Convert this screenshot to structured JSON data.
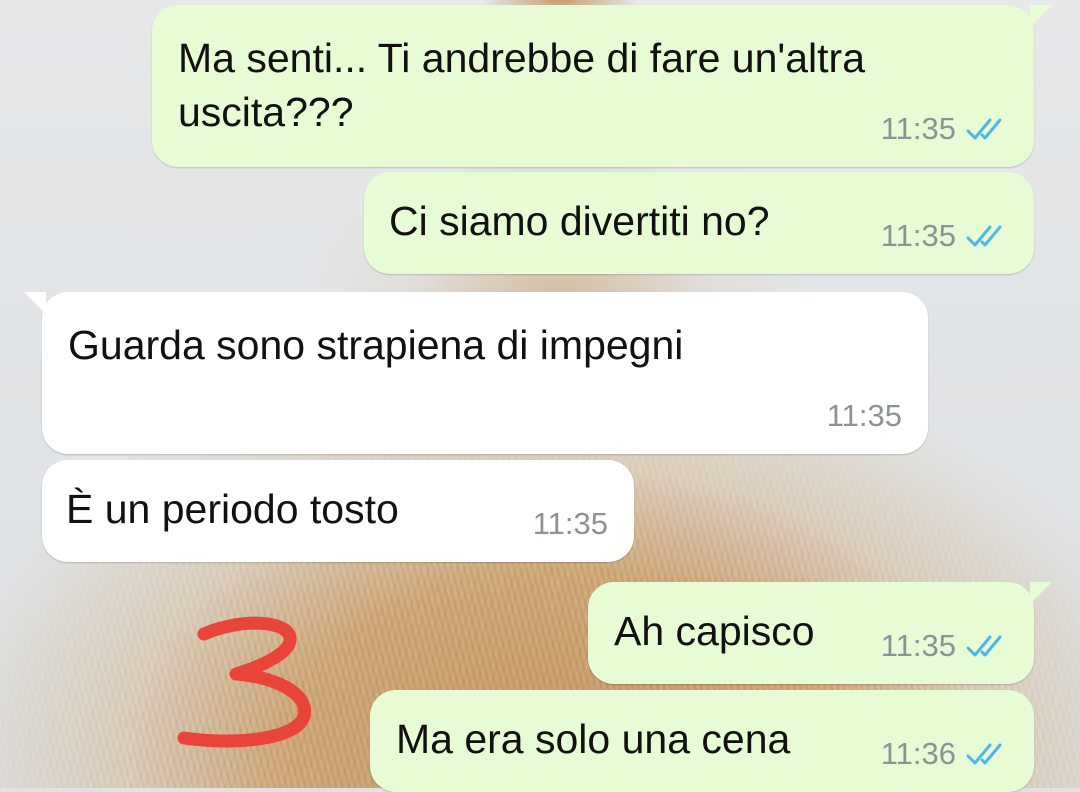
{
  "chat": {
    "messages": [
      {
        "direction": "outgoing",
        "text_line1": "Ma senti... Ti andrebbe di fare un'altra",
        "text_line2": "uscita???",
        "time": "11:35",
        "status": "read"
      },
      {
        "direction": "outgoing",
        "text": "Ci siamo divertiti no?",
        "time": "11:35",
        "status": "read"
      },
      {
        "direction": "incoming",
        "text": "Guarda sono strapiena di impegni",
        "time": "11:35"
      },
      {
        "direction": "incoming",
        "text": "È un periodo tosto",
        "time": "11:35"
      },
      {
        "direction": "outgoing",
        "text": "Ah capisco",
        "time": "11:35",
        "status": "read"
      },
      {
        "direction": "outgoing",
        "text": "Ma era solo una cena",
        "time": "11:36",
        "status": "read"
      }
    ]
  },
  "annotation": {
    "text": "3",
    "color": "#e8443a"
  },
  "colors": {
    "outgoing_bubble": "#e7fcd5",
    "incoming_bubble": "#ffffff",
    "read_ticks": "#4fb6ec",
    "timestamp": "#8b9394"
  },
  "icons": {
    "read_receipt": "double-check-icon"
  }
}
